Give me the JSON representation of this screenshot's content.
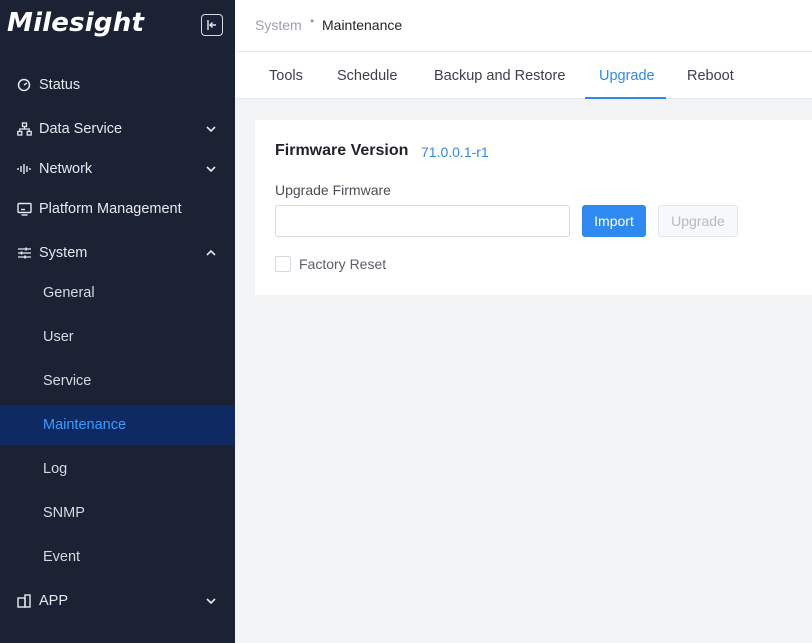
{
  "sidebar": {
    "logo": "Milesight",
    "items": [
      {
        "label": "Status",
        "icon": "status-icon"
      },
      {
        "label": "Data Service",
        "icon": "data-service-icon",
        "chevron": "down"
      },
      {
        "label": "Network",
        "icon": "network-icon",
        "chevron": "down"
      },
      {
        "label": "Platform Management",
        "icon": "monitor-icon"
      },
      {
        "label": "System",
        "icon": "sliders-icon",
        "chevron": "up"
      }
    ],
    "system_sub": [
      {
        "label": "General"
      },
      {
        "label": "User"
      },
      {
        "label": "Service"
      },
      {
        "label": "Maintenance",
        "active": true
      },
      {
        "label": "Log"
      },
      {
        "label": "SNMP"
      },
      {
        "label": "Event"
      }
    ],
    "app": {
      "label": "APP",
      "icon": "app-icon",
      "chevron": "down"
    }
  },
  "breadcrumb": {
    "parent": "System",
    "separator": "•",
    "current": "Maintenance"
  },
  "tabs": [
    {
      "label": "Tools"
    },
    {
      "label": "Schedule"
    },
    {
      "label": "Backup and Restore"
    },
    {
      "label": "Upgrade",
      "active": true
    },
    {
      "label": "Reboot"
    }
  ],
  "firmware": {
    "title": "Firmware Version",
    "version": "71.0.0.1-r1",
    "upgrade_label": "Upgrade Firmware",
    "file_value": "",
    "import_label": "Import",
    "upgrade_button": "Upgrade",
    "factory_reset_label": "Factory Reset",
    "factory_reset_checked": false
  },
  "colors": {
    "sidebar_bg": "#1b2234",
    "active_bg": "#0f2a63",
    "accent": "#2e89f0"
  }
}
